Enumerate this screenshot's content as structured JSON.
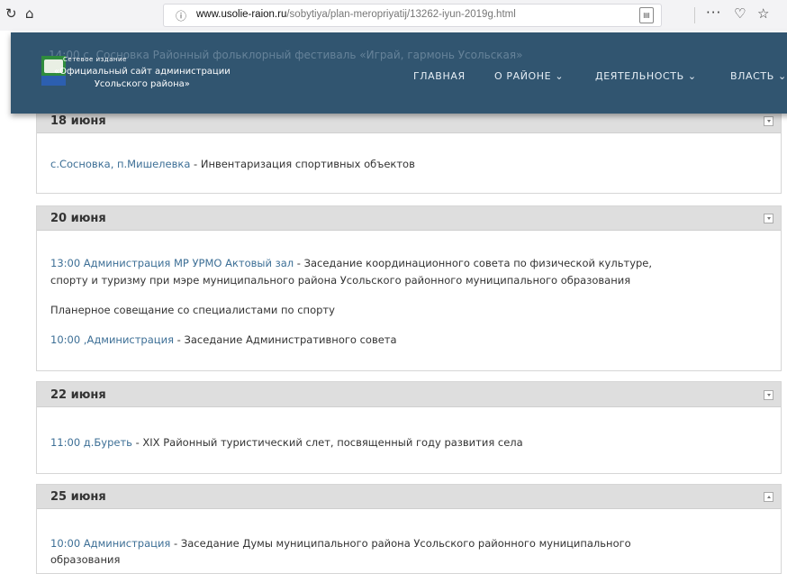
{
  "browser": {
    "url_host": "www.usolie-raion.ru",
    "url_path": "/sobytiya/plan-meropriyatij/13262-iyun-2019g.html"
  },
  "site": {
    "tagline": "Сетевое издание",
    "name_line1": "«Официальный сайт администрации",
    "name_line2": "Усольского района»",
    "ghost_text": "14:00 с. Сосновка Районный фольклорный фестиваль «Играй, гармонь Усольская»",
    "nav": [
      {
        "label": "ГЛАВНАЯ"
      },
      {
        "label": "О РАЙОНЕ ⌄"
      },
      {
        "label": "ДЕЯТЕЛЬНОСТЬ ⌄"
      },
      {
        "label": "ВЛАСТЬ ⌄"
      }
    ]
  },
  "days": [
    {
      "title": "18 июня",
      "events": [
        {
          "link": "с.Сосновка, п.Мишелевка",
          "text": " - Инвентаризация спортивных объектов"
        }
      ]
    },
    {
      "title": "20 июня",
      "events": [
        {
          "link": "13:00 Администрация МР УРМО Актовый зал",
          "text": "  - Заседание координационного совета по физической культуре,"
        },
        {
          "link": "",
          "text": "спорту и туризму при мэре муниципального района Усольского районного муниципального образования"
        },
        {
          "link": "",
          "text": "Планерное совещание со специалистами по спорту"
        },
        {
          "link": "10:00 ,Администрация",
          "text": " - Заседание Административного совета"
        }
      ]
    },
    {
      "title": "22 июня",
      "events": [
        {
          "link": "11:00 д.Буреть",
          "text": " - XIX Районный туристический слет, посвященный году развития села"
        }
      ]
    },
    {
      "title": "25 июня",
      "events": [
        {
          "link": "10:00 Администрация",
          "text": " - Заседание Думы муниципального района Усольского районного муниципального"
        },
        {
          "link": "",
          "text": "образования"
        }
      ]
    }
  ]
}
